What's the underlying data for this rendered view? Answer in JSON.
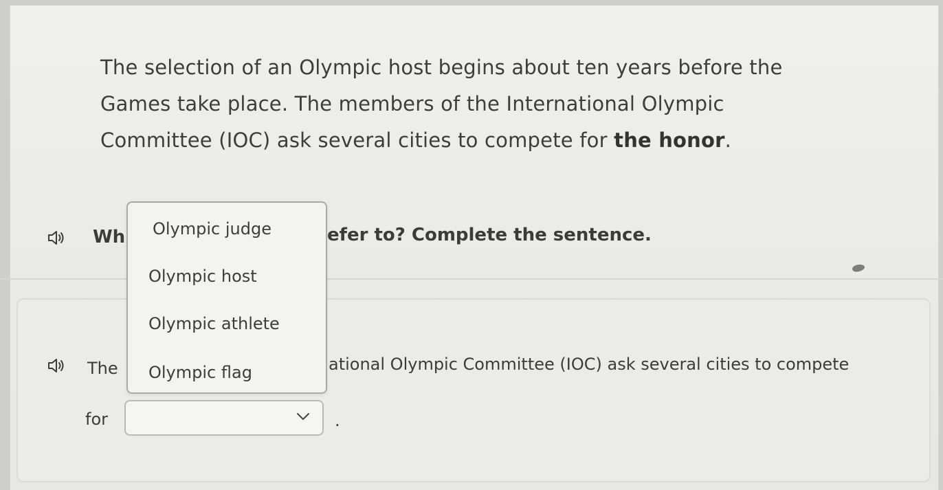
{
  "passage": {
    "line1": "The selection of an Olympic host begins about ten years before the",
    "line2": "Games take place. The members of the International Olympic",
    "line3_prefix": "Committee (IOC) ask several cities to compete for ",
    "line3_bold": "the honor",
    "line3_suffix": "."
  },
  "question": {
    "prefix_visible": "Wh",
    "suffix_visible": "efer to? Complete the sentence."
  },
  "sentence": {
    "prefix_visible": "The",
    "suffix_visible": "ational Olympic Committee (IOC) ask several cities to compete",
    "line2_word": "for",
    "period": "."
  },
  "dropdown": {
    "selected_value": "",
    "options": [
      "Olympic judge",
      "Olympic host",
      "Olympic athlete",
      "Olympic flag"
    ]
  },
  "icons": {
    "audio": "speaker-icon",
    "select_arrow": "chevron-down-icon"
  }
}
